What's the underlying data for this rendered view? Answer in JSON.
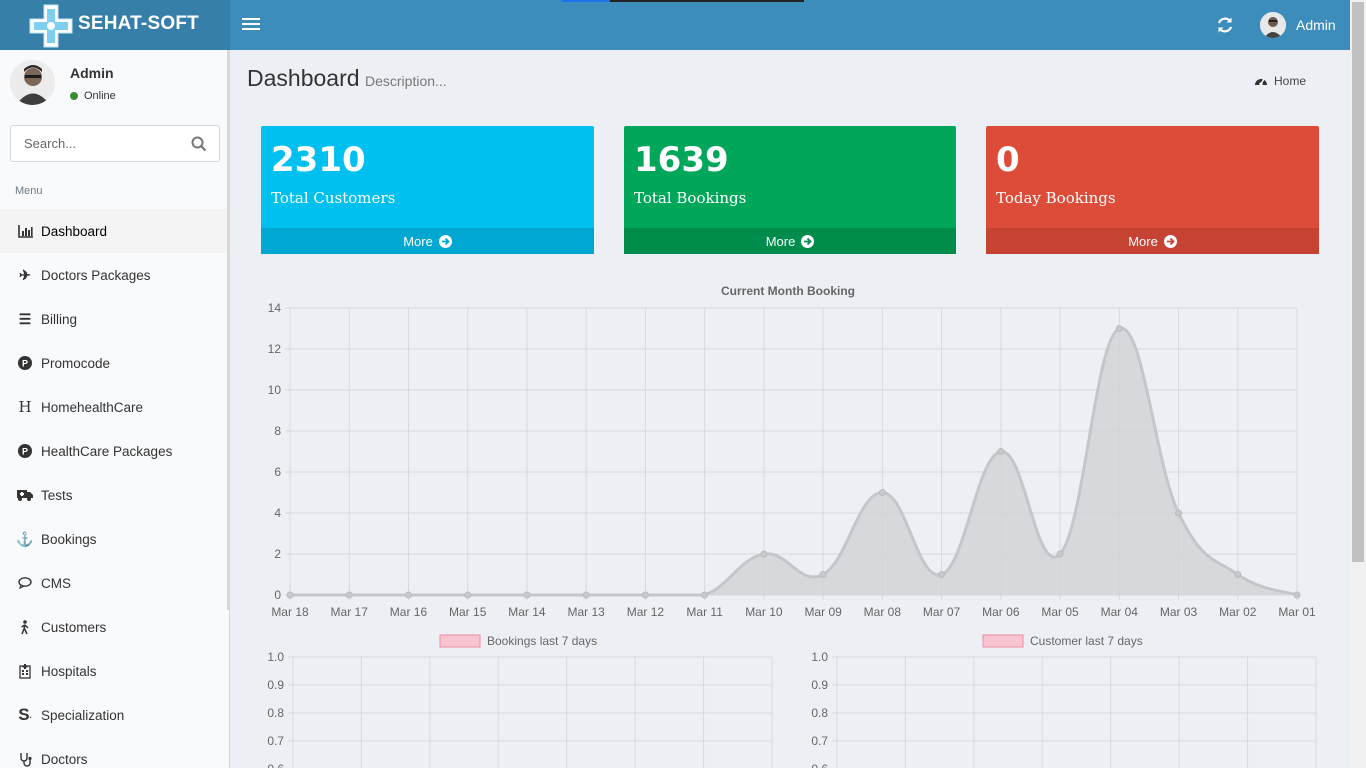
{
  "header": {
    "brand": "SEHAT-SOFT",
    "user_label": "Admin"
  },
  "sidebar": {
    "user_name": "Admin",
    "user_status": "Online",
    "search_placeholder": "Search...",
    "menu_header": "Menu",
    "items": [
      {
        "label": "Dashboard",
        "icon": "bar-chart-icon",
        "active": true
      },
      {
        "label": "Doctors Packages",
        "icon": "plane-icon"
      },
      {
        "label": "Billing",
        "icon": "list-icon"
      },
      {
        "label": "Promocode",
        "icon": "product-hunt-icon"
      },
      {
        "label": "HomehealthCare",
        "icon": "h-icon"
      },
      {
        "label": "HealthCare Packages",
        "icon": "product-hunt-icon"
      },
      {
        "label": "Tests",
        "icon": "ambulance-icon"
      },
      {
        "label": "Bookings",
        "icon": "anchor-icon"
      },
      {
        "label": "CMS",
        "icon": "comment-icon"
      },
      {
        "label": "Customers",
        "icon": "walking-icon"
      },
      {
        "label": "Hospitals",
        "icon": "hospital-icon"
      },
      {
        "label": "Specialization",
        "icon": "s-icon"
      },
      {
        "label": "Doctors",
        "icon": "stethoscope-icon"
      }
    ]
  },
  "page": {
    "title": "Dashboard",
    "description": "Description...",
    "breadcrumb": "Home"
  },
  "stats": [
    {
      "value": "2310",
      "label": "Total Customers",
      "more": "More",
      "color": "#00c0ef"
    },
    {
      "value": "1639",
      "label": "Total Bookings",
      "more": "More",
      "color": "#00a65a"
    },
    {
      "value": "0",
      "label": "Today Bookings",
      "more": "More",
      "color": "#dd4b39"
    }
  ],
  "chart_data": [
    {
      "type": "area",
      "title": "Current Month Booking",
      "categories": [
        "Mar 18",
        "Mar 17",
        "Mar 16",
        "Mar 15",
        "Mar 14",
        "Mar 13",
        "Mar 12",
        "Mar 11",
        "Mar 10",
        "Mar 09",
        "Mar 08",
        "Mar 07",
        "Mar 06",
        "Mar 05",
        "Mar 04",
        "Mar 03",
        "Mar 02",
        "Mar 01"
      ],
      "values": [
        0,
        0,
        0,
        0,
        0,
        0,
        0,
        0,
        2,
        1,
        5,
        1,
        7,
        2,
        13,
        4,
        1,
        0
      ],
      "ylim": [
        0,
        14
      ],
      "yticks": [
        "0",
        "2",
        "4",
        "6",
        "8",
        "10",
        "12",
        "14"
      ],
      "grid": true,
      "fill_color": "#d2d3d6",
      "line_color": "#c5c6c9"
    },
    {
      "type": "bar",
      "legend": "Bookings last 7 days",
      "series": [
        {
          "name": "Bookings last 7 days",
          "values": []
        }
      ],
      "ylim": [
        0,
        1.0
      ],
      "yticks": [
        "1.0",
        "0.9",
        "0.8",
        "0.7",
        "0.6"
      ],
      "legend_color": "#f7c5cf"
    },
    {
      "type": "bar",
      "legend": "Customer last 7 days",
      "series": [
        {
          "name": "Customer last 7 days",
          "values": []
        }
      ],
      "ylim": [
        0,
        1.0
      ],
      "yticks": [
        "1.0",
        "0.9",
        "0.8",
        "0.7",
        "0.6"
      ],
      "legend_color": "#f7c5cf"
    }
  ]
}
